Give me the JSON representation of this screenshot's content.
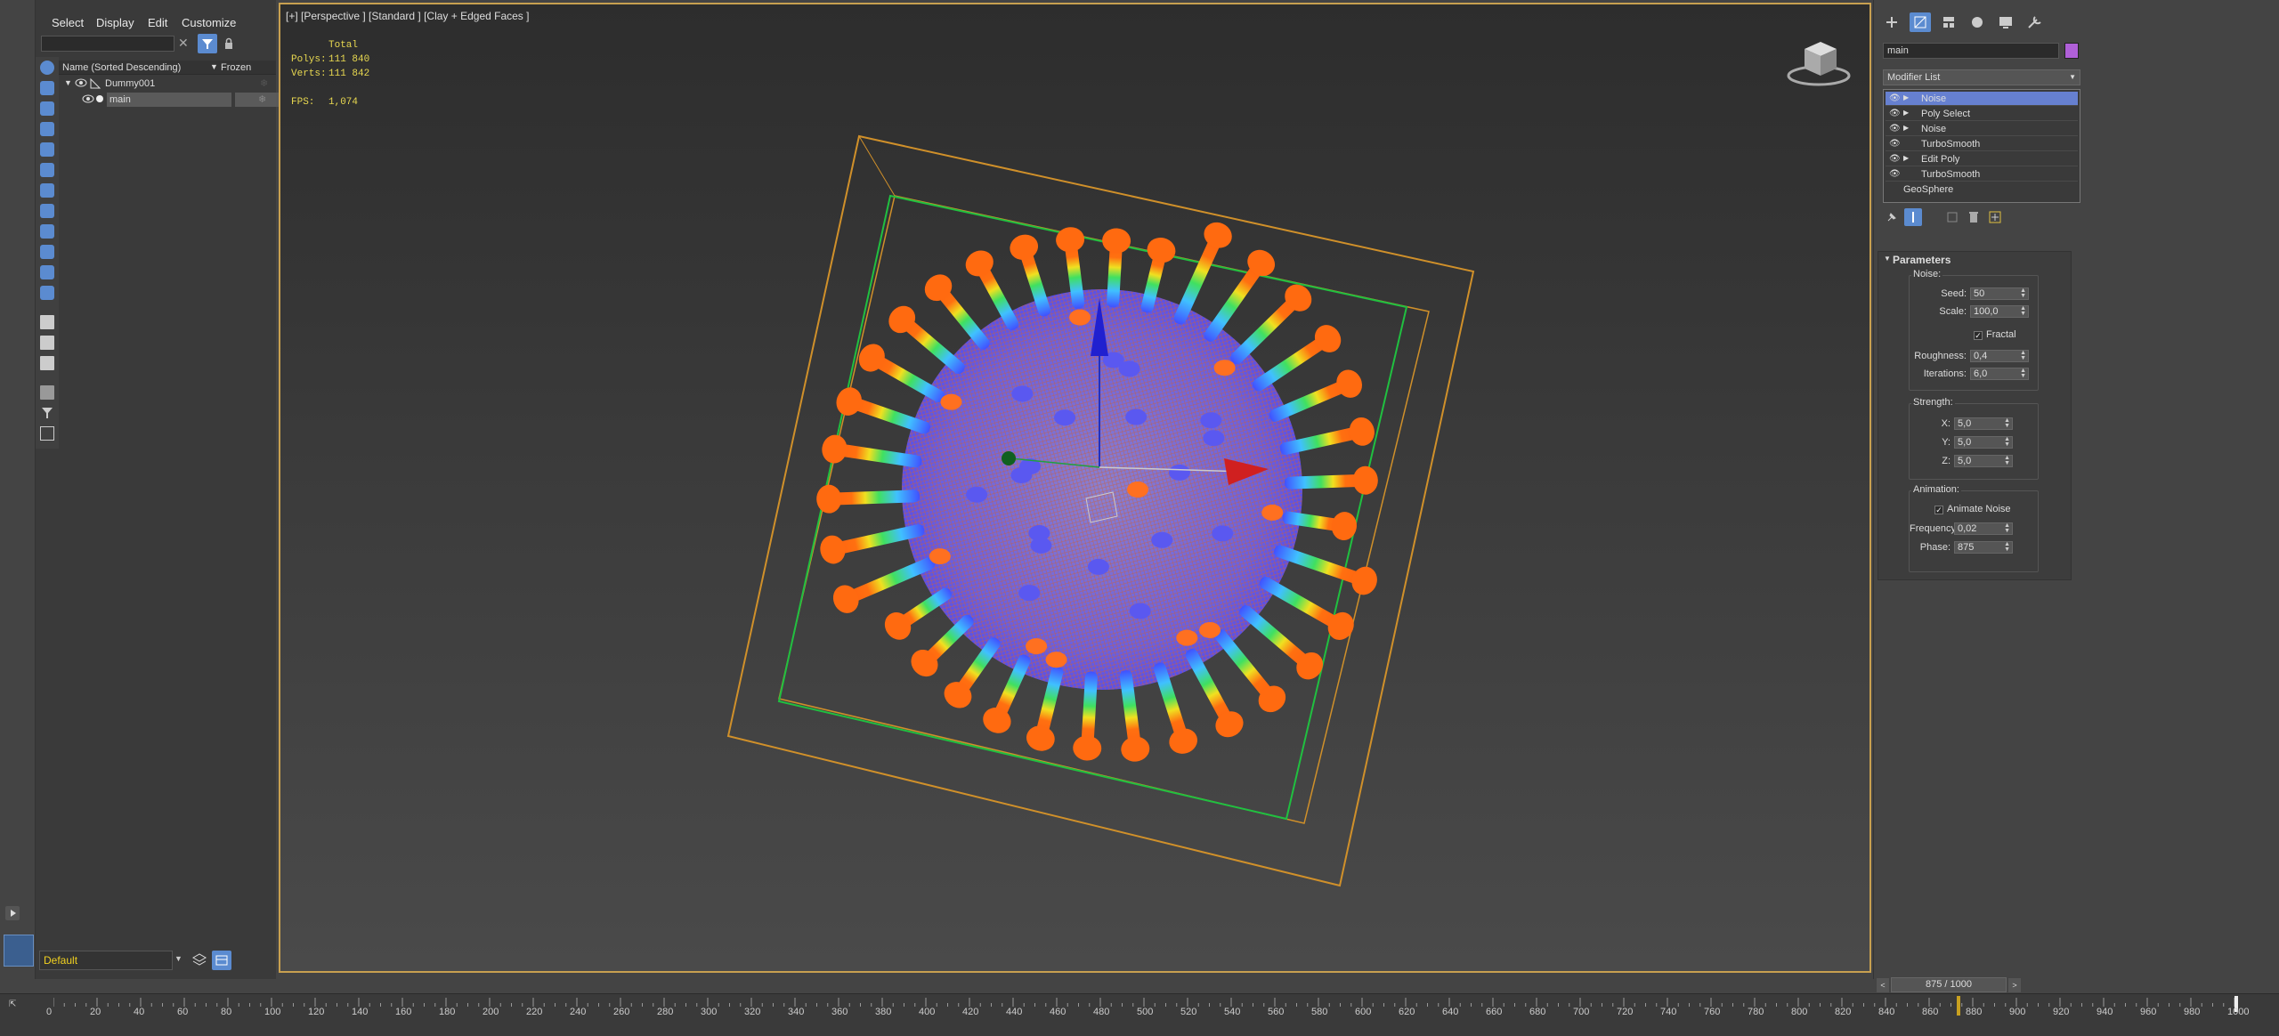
{
  "menubar": {
    "items": [
      "Select",
      "Display",
      "Edit",
      "Customize"
    ]
  },
  "scene_explorer": {
    "column_name": "Name (Sorted Descending)",
    "column_frozen": "Frozen",
    "rows": [
      {
        "label": "Dummy001"
      },
      {
        "label": "main"
      }
    ]
  },
  "viewport": {
    "label": "[+] [Perspective ] [Standard ] [Clay + Edged Faces ]",
    "stats": {
      "total_label": "Total",
      "polys_label": "Polys:",
      "polys_value": "111 840",
      "verts_label": "Verts:",
      "verts_value": "111 842",
      "fps_label": "FPS:",
      "fps_value": "1,074"
    }
  },
  "command_panel": {
    "object_name": "main",
    "object_color": "#b060d8",
    "modifier_list_label": "Modifier List",
    "stack": [
      "Noise",
      "Poly Select",
      "Noise",
      "TurboSmooth",
      "Edit Poly",
      "TurboSmooth",
      "GeoSphere"
    ],
    "params": {
      "rollout_title": "Parameters",
      "noise_group": "Noise:",
      "seed_label": "Seed:",
      "seed_value": "50",
      "scale_label": "Scale:",
      "scale_value": "100,0",
      "fractal_label": "Fractal",
      "roughness_label": "Roughness:",
      "roughness_value": "0,4",
      "iterations_label": "Iterations:",
      "iterations_value": "6,0",
      "strength_group": "Strength:",
      "x_label": "X:",
      "x_value": "5,0",
      "y_label": "Y:",
      "y_value": "5,0",
      "z_label": "Z:",
      "z_value": "5,0",
      "animation_group": "Animation:",
      "animate_noise_label": "Animate Noise",
      "frequency_label": "Frequency:",
      "frequency_value": "0,02",
      "phase_label": "Phase:",
      "phase_value": "875"
    }
  },
  "bottom": {
    "layer_name": "Default",
    "frame_display": "875 / 1000",
    "tick_labels": [
      "0",
      "20",
      "40",
      "60",
      "80",
      "100",
      "120",
      "140",
      "160",
      "180",
      "200",
      "220",
      "240",
      "260",
      "280",
      "300",
      "320",
      "340",
      "360",
      "380",
      "400",
      "420",
      "440",
      "460",
      "480",
      "500",
      "520",
      "540",
      "560",
      "580",
      "600",
      "620",
      "640",
      "660",
      "680",
      "700",
      "720",
      "740",
      "760",
      "780",
      "800",
      "820",
      "840",
      "860",
      "880",
      "900",
      "920",
      "940",
      "960",
      "980",
      "1000"
    ]
  }
}
